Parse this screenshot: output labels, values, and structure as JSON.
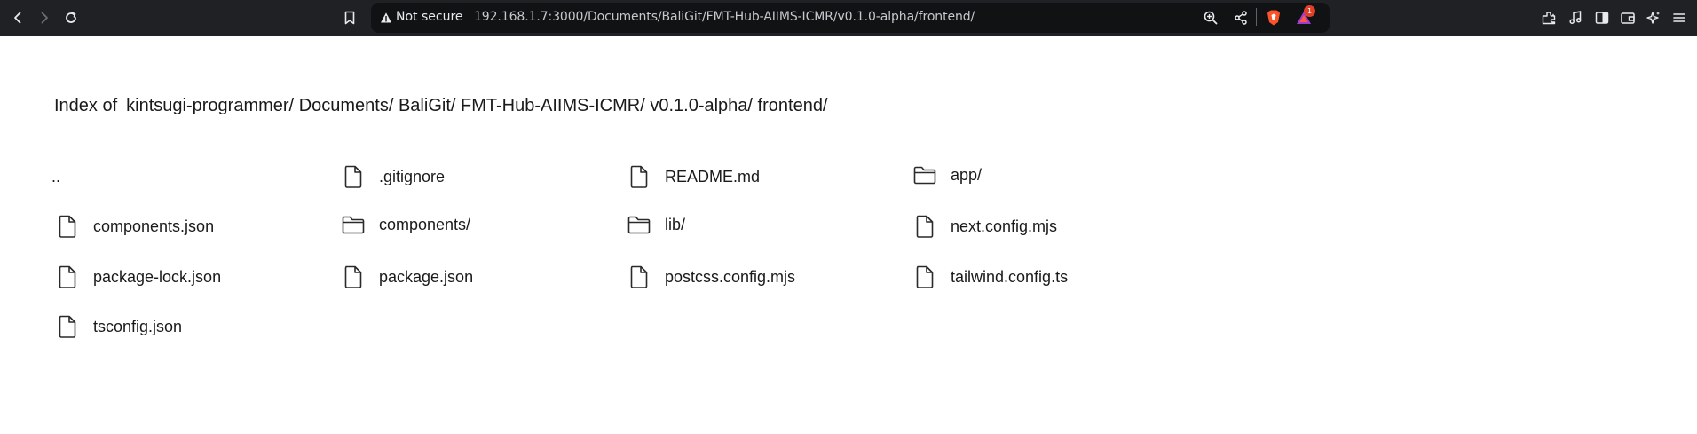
{
  "browser": {
    "security_label": "Not secure",
    "url": "192.168.1.7:3000/Documents/BaliGit/FMT-Hub-AIIMS-ICMR/v0.1.0-alpha/frontend/",
    "notification_count": "1",
    "toolbar_icons": [
      "back-icon",
      "forward-icon",
      "reload-icon",
      "bookmark-icon",
      "warning-icon",
      "zoom-icon",
      "share-icon",
      "brave-shields-icon",
      "brave-rewards-icon",
      "extensions-icon",
      "media-icon",
      "sidebar-icon",
      "wallet-icon",
      "leo-ai-icon",
      "menu-icon"
    ],
    "colors": {
      "toolbar": "#202124",
      "omnibox": "#111214",
      "shield": "#fb542b",
      "badge": "#e0402a"
    }
  },
  "page": {
    "index_label": "Index of",
    "breadcrumbs": [
      "kintsugi-programmer/",
      "Documents/",
      "BaliGit/",
      "FMT-Hub-AIIMS-ICMR/",
      "v0.1.0-alpha/",
      "frontend/"
    ],
    "entries": [
      {
        "name": "..",
        "type": "parent"
      },
      {
        "name": ".gitignore",
        "type": "file"
      },
      {
        "name": "README.md",
        "type": "file"
      },
      {
        "name": "app/",
        "type": "folder"
      },
      {
        "name": "components.json",
        "type": "file"
      },
      {
        "name": "components/",
        "type": "folder"
      },
      {
        "name": "lib/",
        "type": "folder"
      },
      {
        "name": "next.config.mjs",
        "type": "file"
      },
      {
        "name": "package-lock.json",
        "type": "file"
      },
      {
        "name": "package.json",
        "type": "file"
      },
      {
        "name": "postcss.config.mjs",
        "type": "file"
      },
      {
        "name": "tailwind.config.ts",
        "type": "file"
      },
      {
        "name": "tsconfig.json",
        "type": "file"
      }
    ]
  }
}
